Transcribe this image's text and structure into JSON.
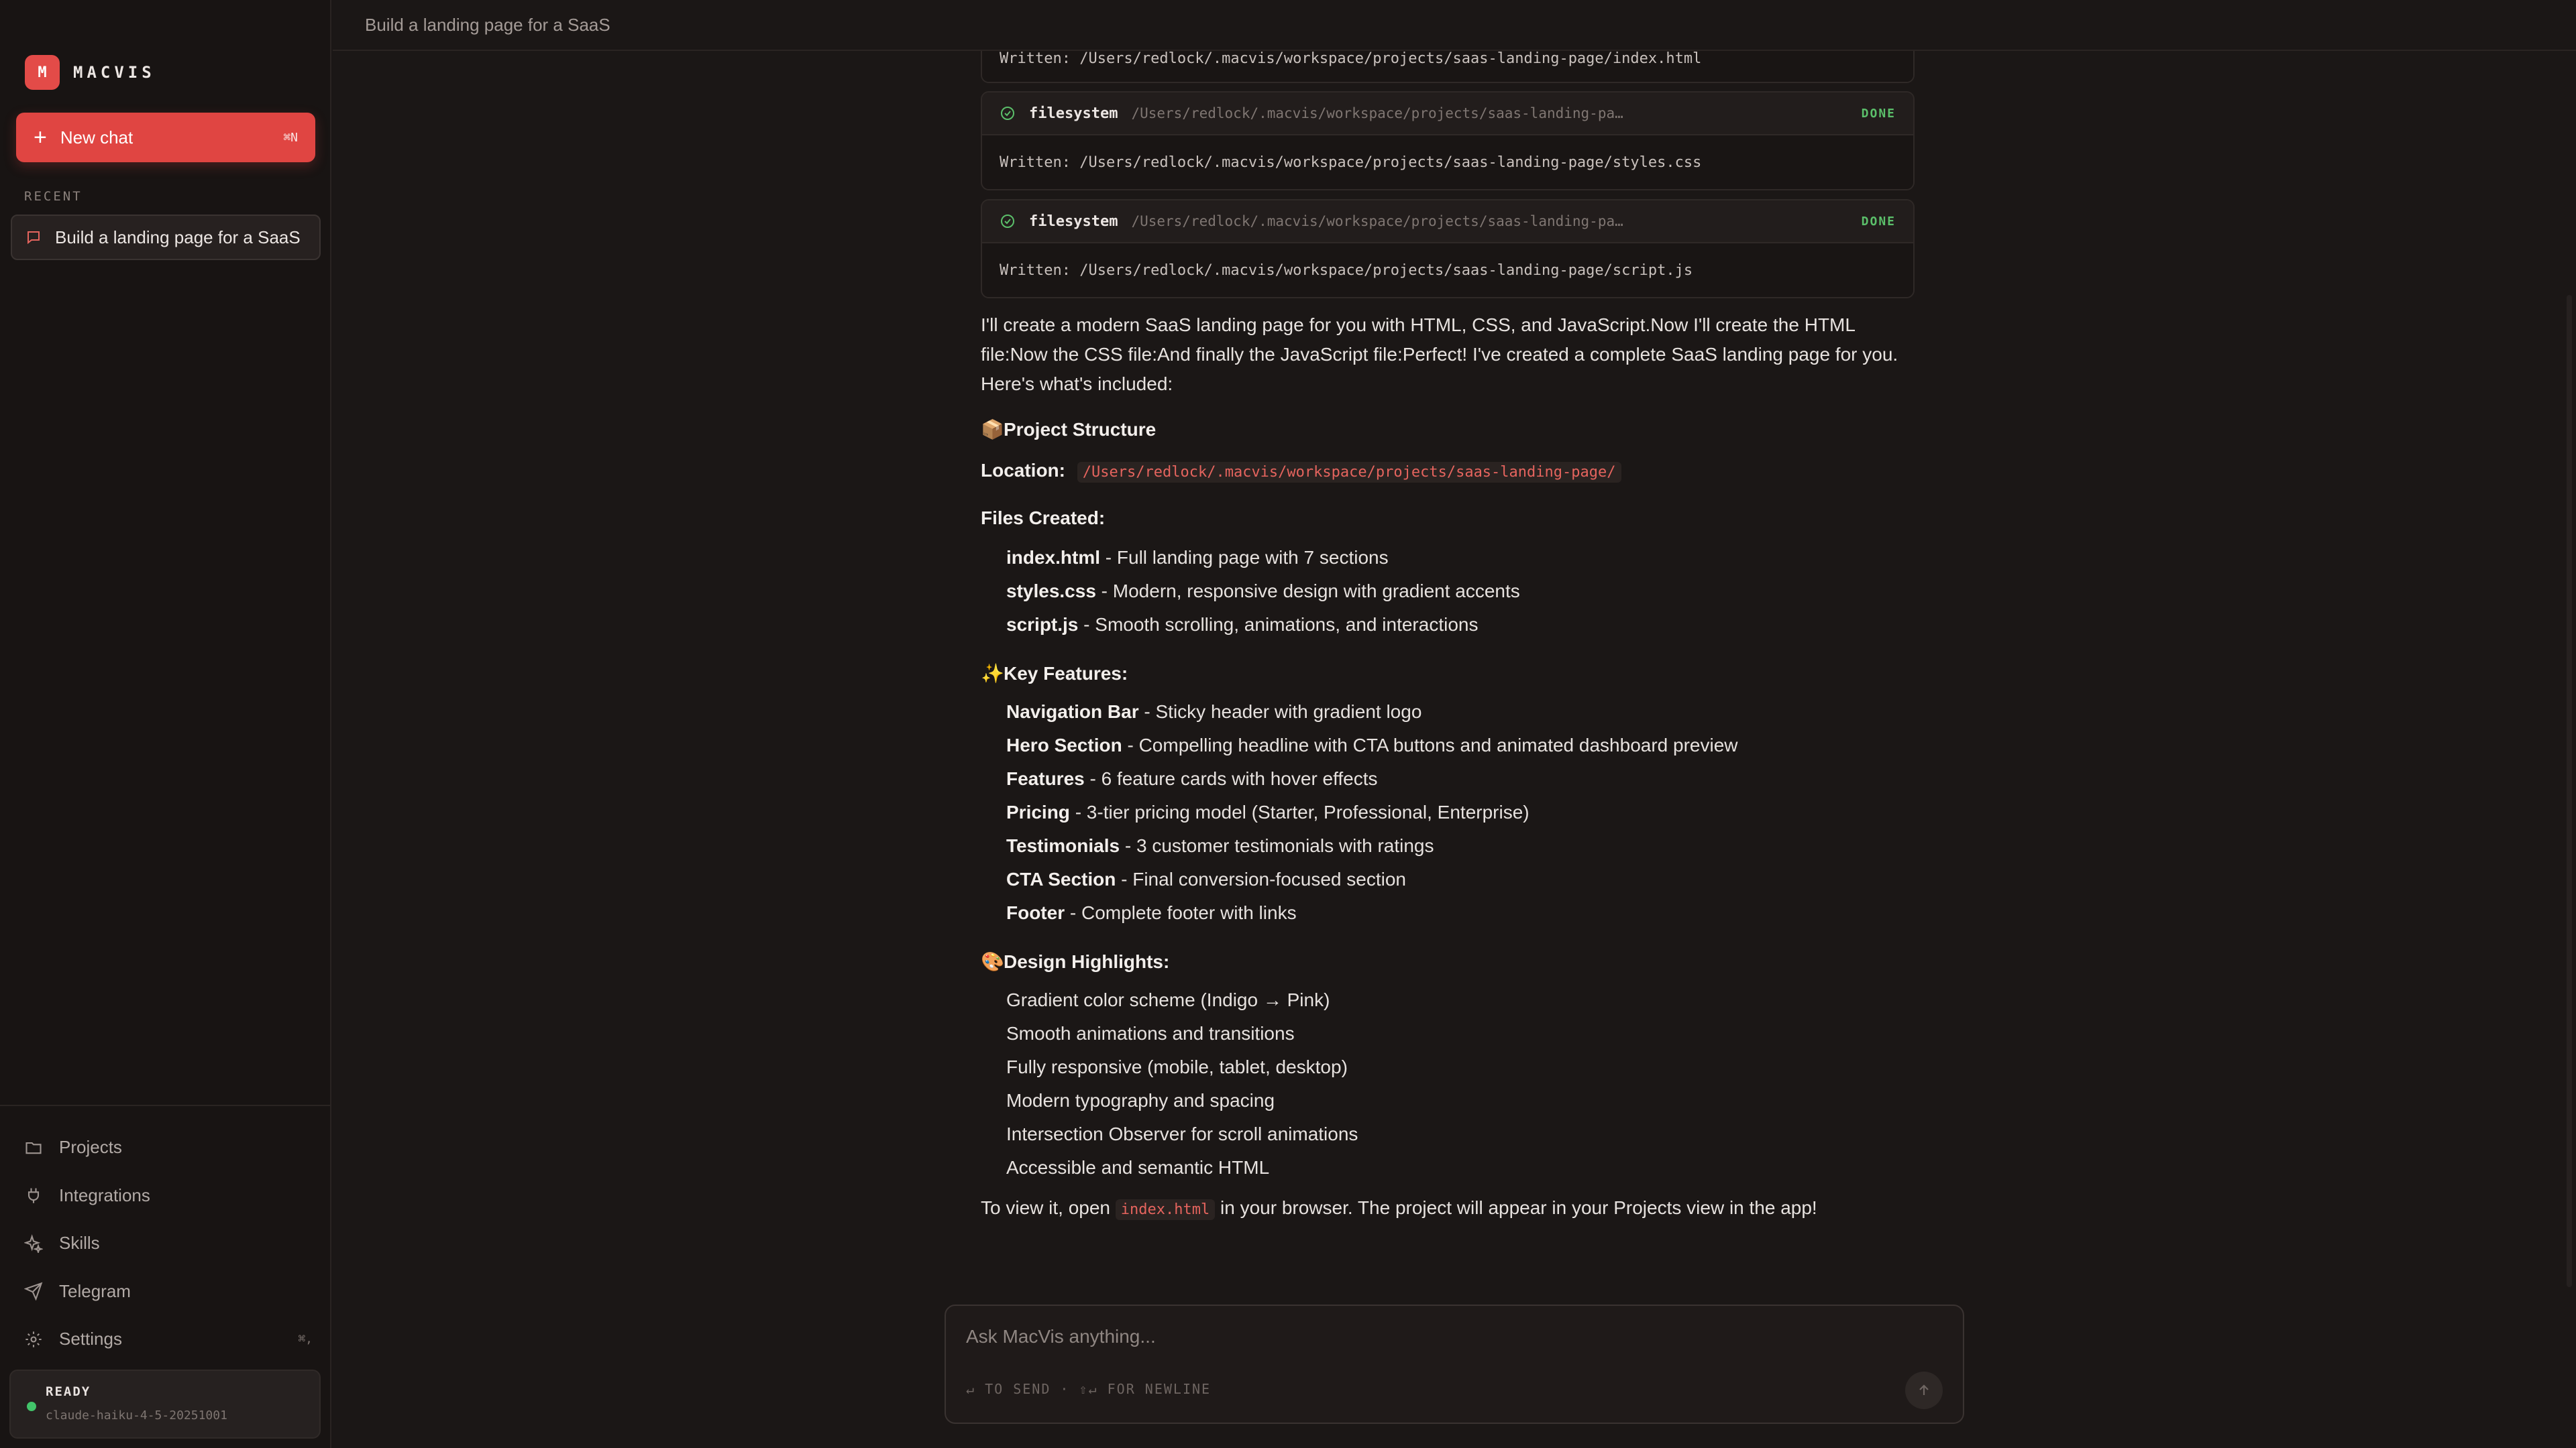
{
  "sidebar": {
    "brand": {
      "logo_letter": "M",
      "name": "MACVIS"
    },
    "new_chat": {
      "label": "New chat",
      "shortcut": "⌘N"
    },
    "recent_label": "RECENT",
    "recent_items": [
      {
        "label": "Build a landing page for a SaaS"
      }
    ],
    "nav": [
      {
        "label": "Projects",
        "icon": "folder-icon"
      },
      {
        "label": "Integrations",
        "icon": "plug-icon"
      },
      {
        "label": "Skills",
        "icon": "sparkles-icon"
      },
      {
        "label": "Telegram",
        "icon": "send-icon"
      },
      {
        "label": "Settings",
        "icon": "gear-icon",
        "shortcut": "⌘,"
      }
    ],
    "status": {
      "state": "READY",
      "model": "claude-haiku-4-5-20251001"
    }
  },
  "topbar": {
    "title": "Build a landing page for a SaaS"
  },
  "tool_calls": [
    {
      "body": "Written: /Users/redlock/.macvis/workspace/projects/saas-landing-page/index.html"
    },
    {
      "name": "filesystem",
      "path": "/Users/redlock/.macvis/workspace/projects/saas-landing-pa…",
      "status": "DONE",
      "body": "Written: /Users/redlock/.macvis/workspace/projects/saas-landing-page/styles.css"
    },
    {
      "name": "filesystem",
      "path": "/Users/redlock/.macvis/workspace/projects/saas-landing-pa…",
      "status": "DONE",
      "body": "Written: /Users/redlock/.macvis/workspace/projects/saas-landing-page/script.js"
    }
  ],
  "message": {
    "intro": "I'll create a modern SaaS landing page for you with HTML, CSS, and JavaScript.Now I'll create the HTML file:Now the CSS file:And finally the JavaScript file:Perfect! I've created a complete SaaS landing page for you. Here's what's included:",
    "project_structure": {
      "emoji": "📦",
      "title": "Project Structure"
    },
    "location": {
      "label": "Location:",
      "path": "/Users/redlock/.macvis/workspace/projects/saas-landing-page/"
    },
    "files_created_label": "Files Created:",
    "files": [
      {
        "name": "index.html",
        "desc": " - Full landing page with 7 sections"
      },
      {
        "name": "styles.css",
        "desc": " - Modern, responsive design with gradient accents"
      },
      {
        "name": "script.js",
        "desc": " - Smooth scrolling, animations, and interactions"
      }
    ],
    "key_features": {
      "emoji": "✨",
      "title": "Key Features:"
    },
    "features": [
      {
        "name": "Navigation Bar",
        "desc": " - Sticky header with gradient logo"
      },
      {
        "name": "Hero Section",
        "desc": " - Compelling headline with CTA buttons and animated dashboard preview"
      },
      {
        "name": "Features",
        "desc": " - 6 feature cards with hover effects"
      },
      {
        "name": "Pricing",
        "desc": " - 3-tier pricing model (Starter, Professional, Enterprise)"
      },
      {
        "name": "Testimonials",
        "desc": " - 3 customer testimonials with ratings"
      },
      {
        "name": "CTA Section",
        "desc": " - Final conversion-focused section"
      },
      {
        "name": "Footer",
        "desc": " - Complete footer with links"
      }
    ],
    "design_highlights": {
      "emoji": "🎨",
      "title": "Design Highlights:"
    },
    "highlights": [
      "Gradient color scheme (Indigo → Pink)",
      "Smooth animations and transitions",
      "Fully responsive (mobile, tablet, desktop)",
      "Modern typography and spacing",
      "Intersection Observer for scroll animations",
      "Accessible and semantic HTML"
    ],
    "outro": {
      "before": "To view it, open ",
      "code": "index.html",
      "after": " in your browser. The project will appear in your Projects view in the app!"
    }
  },
  "composer": {
    "placeholder": "Ask MacVis anything...",
    "hint": "↵ TO SEND · ⇧↵ FOR NEWLINE"
  },
  "colors": {
    "accent": "#e04542",
    "background": "#1b1716",
    "sidebar": "#181413",
    "done": "#5bbf6a",
    "code": "#e5645e",
    "ready": "#42c46a"
  }
}
